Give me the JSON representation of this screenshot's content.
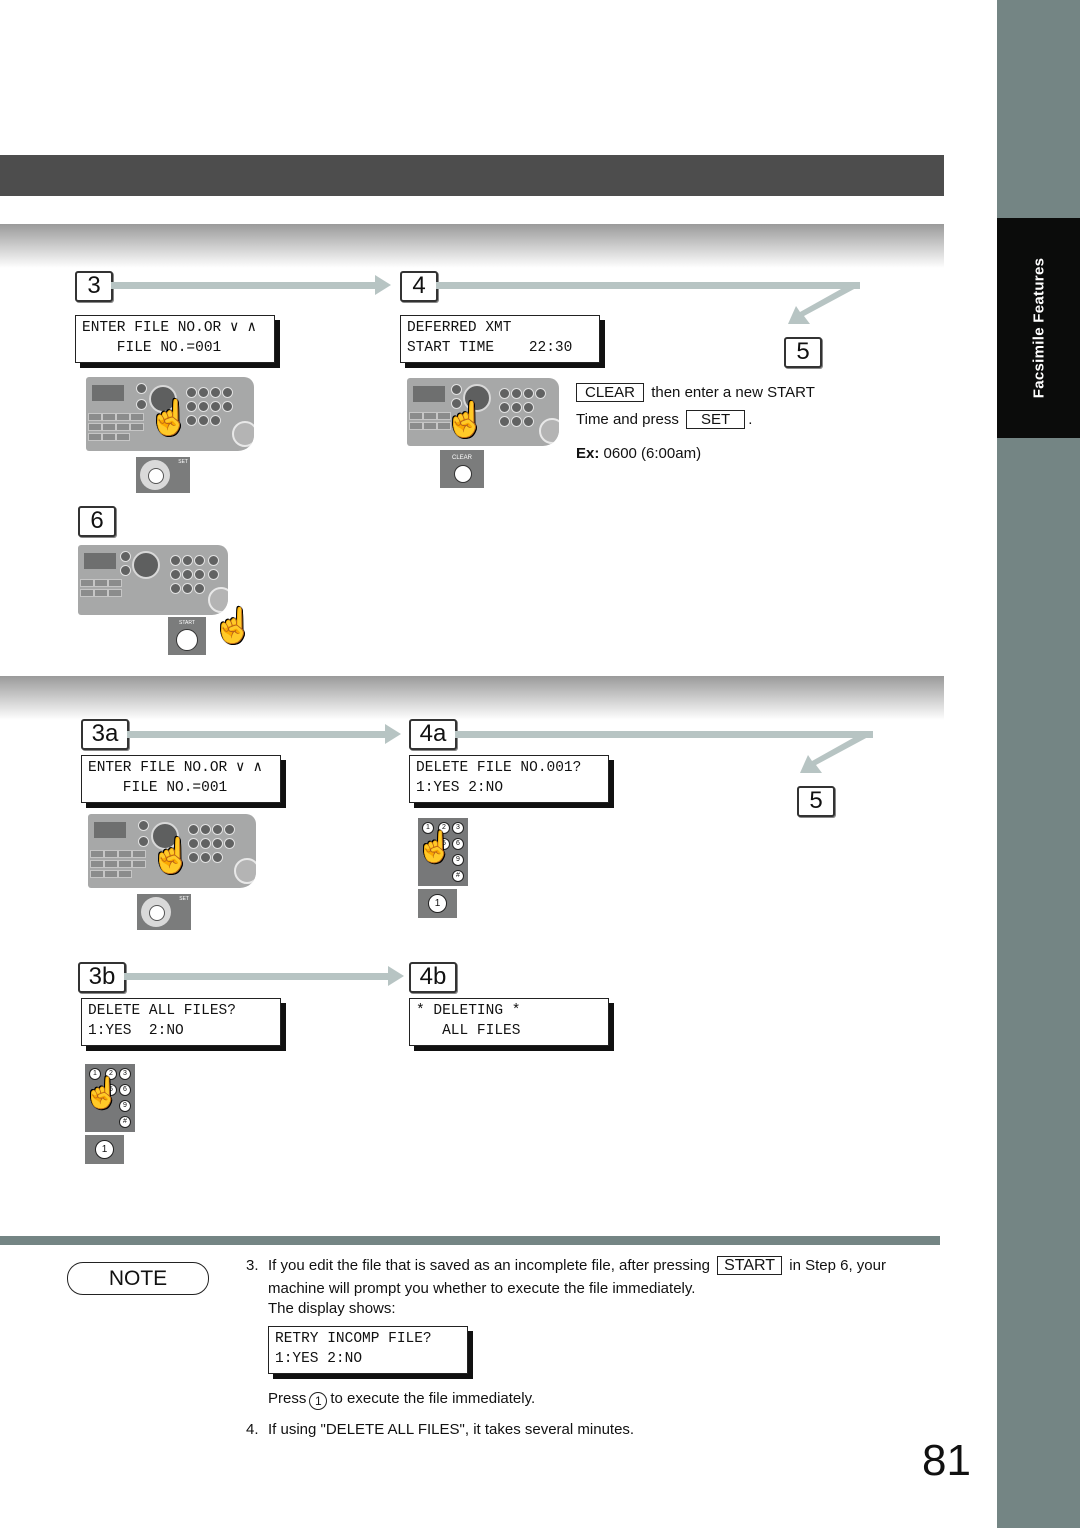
{
  "sidebar": {
    "tab_label": "Facsimile Features"
  },
  "section1": {
    "steps": {
      "s3": {
        "num": "3",
        "lcd_line1": "ENTER FILE NO.OR ∨ ∧",
        "lcd_line2": "    FILE NO.=001",
        "inset_label": "SET"
      },
      "s4": {
        "num": "4",
        "lcd_line1": "DEFERRED XMT",
        "lcd_line2": "START TIME    22:30",
        "inset_label": "CLEAR"
      },
      "s5": {
        "num": "5",
        "key_clear": "CLEAR",
        "text1": "then enter a new START",
        "text2": "Time and press",
        "key_set": "SET",
        "text3": ".",
        "ex_label": "Ex:",
        "ex_value": "0600 (6:00am)"
      },
      "s6": {
        "num": "6",
        "inset_label": "START"
      }
    }
  },
  "section2": {
    "steps": {
      "s3a": {
        "num": "3a",
        "lcd_line1": "ENTER FILE NO.OR ∨ ∧",
        "lcd_line2": "    FILE NO.=001",
        "inset_label": "SET"
      },
      "s4a": {
        "num": "4a",
        "lcd_line1": "DELETE FILE NO.001?",
        "lcd_line2": "1:YES 2:NO",
        "key_label": "1"
      },
      "s5": {
        "num": "5"
      },
      "s3b": {
        "num": "3b",
        "lcd_line1": "DELETE ALL FILES?",
        "lcd_line2": "1:YES  2:NO",
        "key_label": "1"
      },
      "s4b": {
        "num": "4b",
        "lcd_line1": "* DELETING *",
        "lcd_line2": "   ALL FILES"
      }
    }
  },
  "keypad_keys": [
    "1",
    "2",
    "3",
    "5",
    "6",
    "9",
    "#"
  ],
  "note": {
    "label": "NOTE",
    "item3": {
      "num": "3.",
      "text_a": "If you edit the file that is saved as an incomplete file, after pressing",
      "key": "START",
      "text_b": "in Step 6, your",
      "text_c": "machine will prompt you whether to execute the file immediately.",
      "text_d": "The display shows:",
      "lcd_line1": "RETRY INCOMP FILE?",
      "lcd_line2": "1:YES 2:NO",
      "press_a": "Press",
      "press_key": "1",
      "press_b": "to execute the file immediately."
    },
    "item4": {
      "num": "4.",
      "text": "If using \"DELETE ALL FILES\", it takes several minutes."
    }
  },
  "page_number": "81"
}
